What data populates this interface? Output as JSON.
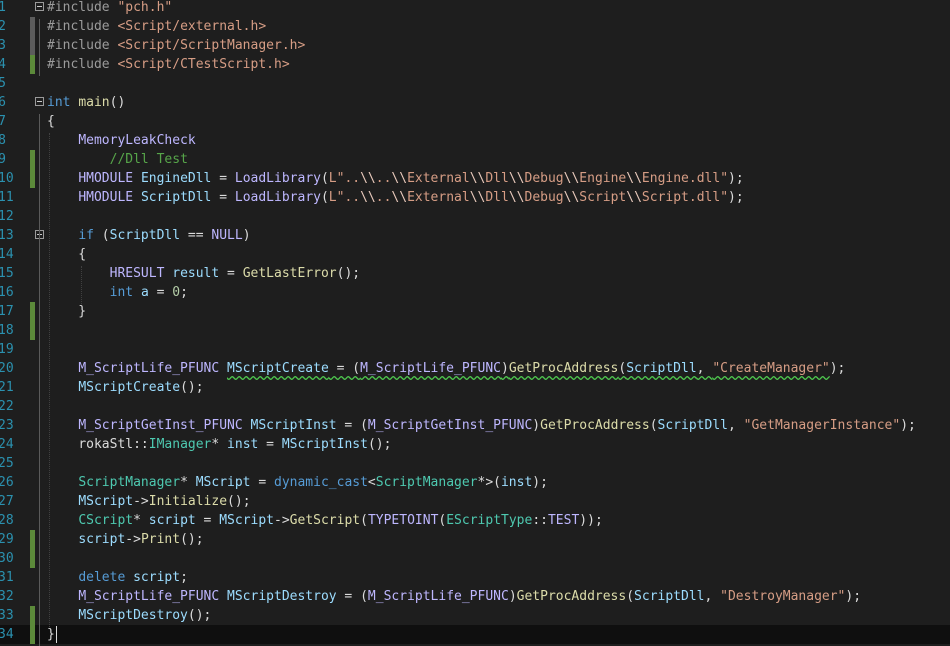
{
  "editor": {
    "lines": [
      {
        "num": "1",
        "change": "none",
        "fold": true,
        "tokens": [
          {
            "t": "#include ",
            "c": "pre"
          },
          {
            "t": "\"pch.h\"",
            "c": "str"
          }
        ]
      },
      {
        "num": "2",
        "change": "edited",
        "fold": false,
        "tokens": [
          {
            "t": "#include ",
            "c": "pre"
          },
          {
            "t": "<Script/external.h>",
            "c": "str"
          }
        ]
      },
      {
        "num": "3",
        "change": "edited",
        "fold": false,
        "tokens": [
          {
            "t": "#include ",
            "c": "pre"
          },
          {
            "t": "<Script/ScriptManager.h>",
            "c": "str"
          }
        ]
      },
      {
        "num": "4",
        "change": "saved",
        "fold": false,
        "tokens": [
          {
            "t": "#include ",
            "c": "pre"
          },
          {
            "t": "<Script/CTestScript.h>",
            "c": "str"
          }
        ]
      },
      {
        "num": "5",
        "change": "none",
        "fold": false,
        "tokens": []
      },
      {
        "num": "6",
        "change": "none",
        "fold": true,
        "tokens": [
          {
            "t": "int",
            "c": "kw"
          },
          {
            "t": " ",
            "c": "pl"
          },
          {
            "t": "main",
            "c": "fn"
          },
          {
            "t": "()",
            "c": "pl"
          }
        ]
      },
      {
        "num": "7",
        "change": "none",
        "fold": false,
        "tokens": [
          {
            "t": "{",
            "c": "pl"
          }
        ]
      },
      {
        "num": "8",
        "change": "none",
        "fold": false,
        "tokens": [
          {
            "t": "    ",
            "c": "pl"
          },
          {
            "t": "MemoryLeakCheck",
            "c": "mac"
          }
        ]
      },
      {
        "num": "9",
        "change": "saved",
        "fold": false,
        "tokens": [
          {
            "t": "        ",
            "c": "pl"
          },
          {
            "t": "//Dll Test",
            "c": "com"
          }
        ]
      },
      {
        "num": "10",
        "change": "saved",
        "fold": false,
        "tokens": [
          {
            "t": "    ",
            "c": "pl"
          },
          {
            "t": "HMODULE",
            "c": "mac"
          },
          {
            "t": " ",
            "c": "pl"
          },
          {
            "t": "EngineDll",
            "c": "var"
          },
          {
            "t": " = ",
            "c": "pl"
          },
          {
            "t": "LoadLibrary",
            "c": "mac"
          },
          {
            "t": "(",
            "c": "pl"
          },
          {
            "t": "L\"..",
            "c": "str"
          },
          {
            "t": "\\\\",
            "c": "esc"
          },
          {
            "t": "..",
            "c": "str"
          },
          {
            "t": "\\\\",
            "c": "esc"
          },
          {
            "t": "External",
            "c": "str"
          },
          {
            "t": "\\\\",
            "c": "esc"
          },
          {
            "t": "Dll",
            "c": "str"
          },
          {
            "t": "\\\\",
            "c": "esc"
          },
          {
            "t": "Debug",
            "c": "str"
          },
          {
            "t": "\\\\",
            "c": "esc"
          },
          {
            "t": "Engine",
            "c": "str"
          },
          {
            "t": "\\\\",
            "c": "esc"
          },
          {
            "t": "Engine.dll\"",
            "c": "str"
          },
          {
            "t": ");",
            "c": "pl"
          }
        ]
      },
      {
        "num": "11",
        "change": "none",
        "fold": false,
        "tokens": [
          {
            "t": "    ",
            "c": "pl"
          },
          {
            "t": "HMODULE",
            "c": "mac"
          },
          {
            "t": " ",
            "c": "pl"
          },
          {
            "t": "ScriptDll",
            "c": "var"
          },
          {
            "t": " = ",
            "c": "pl"
          },
          {
            "t": "LoadLibrary",
            "c": "mac"
          },
          {
            "t": "(",
            "c": "pl"
          },
          {
            "t": "L\"..",
            "c": "str"
          },
          {
            "t": "\\\\",
            "c": "esc"
          },
          {
            "t": "..",
            "c": "str"
          },
          {
            "t": "\\\\",
            "c": "esc"
          },
          {
            "t": "External",
            "c": "str"
          },
          {
            "t": "\\\\",
            "c": "esc"
          },
          {
            "t": "Dll",
            "c": "str"
          },
          {
            "t": "\\\\",
            "c": "esc"
          },
          {
            "t": "Debug",
            "c": "str"
          },
          {
            "t": "\\\\",
            "c": "esc"
          },
          {
            "t": "Script",
            "c": "str"
          },
          {
            "t": "\\\\",
            "c": "esc"
          },
          {
            "t": "Script.dll\"",
            "c": "str"
          },
          {
            "t": ");",
            "c": "pl"
          }
        ]
      },
      {
        "num": "12",
        "change": "none",
        "fold": false,
        "tokens": []
      },
      {
        "num": "13",
        "change": "none",
        "fold": true,
        "tokens": [
          {
            "t": "    ",
            "c": "pl"
          },
          {
            "t": "if",
            "c": "kw"
          },
          {
            "t": " (",
            "c": "pl"
          },
          {
            "t": "ScriptDll",
            "c": "var"
          },
          {
            "t": " == ",
            "c": "pl"
          },
          {
            "t": "NULL",
            "c": "mac"
          },
          {
            "t": ")",
            "c": "pl"
          }
        ]
      },
      {
        "num": "14",
        "change": "none",
        "fold": false,
        "tokens": [
          {
            "t": "    {",
            "c": "pl"
          }
        ]
      },
      {
        "num": "15",
        "change": "none",
        "fold": false,
        "tokens": [
          {
            "t": "        ",
            "c": "pl"
          },
          {
            "t": "HRESULT",
            "c": "mac"
          },
          {
            "t": " ",
            "c": "pl"
          },
          {
            "t": "result",
            "c": "var"
          },
          {
            "t": " = ",
            "c": "pl"
          },
          {
            "t": "GetLastError",
            "c": "fn"
          },
          {
            "t": "();",
            "c": "pl"
          }
        ]
      },
      {
        "num": "16",
        "change": "none",
        "fold": false,
        "tokens": [
          {
            "t": "        ",
            "c": "pl"
          },
          {
            "t": "int",
            "c": "kw"
          },
          {
            "t": " ",
            "c": "pl"
          },
          {
            "t": "a",
            "c": "var"
          },
          {
            "t": " = ",
            "c": "pl"
          },
          {
            "t": "0",
            "c": "num"
          },
          {
            "t": ";",
            "c": "pl"
          }
        ]
      },
      {
        "num": "17",
        "change": "saved",
        "fold": false,
        "tokens": [
          {
            "t": "    }",
            "c": "pl"
          }
        ]
      },
      {
        "num": "18",
        "change": "saved",
        "fold": false,
        "tokens": []
      },
      {
        "num": "19",
        "change": "none",
        "fold": false,
        "tokens": []
      },
      {
        "num": "20",
        "change": "none",
        "fold": false,
        "tokens": [
          {
            "t": "    ",
            "c": "pl"
          },
          {
            "t": "M_ScriptLife_PFUNC",
            "c": "mac"
          },
          {
            "t": " ",
            "c": "pl"
          },
          {
            "t": "MScriptCreate",
            "c": "var",
            "squig": true
          },
          {
            "t": " = (",
            "c": "pl",
            "squig": true
          },
          {
            "t": "M_ScriptLife_PFUNC",
            "c": "mac",
            "squig": true
          },
          {
            "t": ")",
            "c": "pl",
            "squig": true
          },
          {
            "t": "GetProcAddress",
            "c": "fn",
            "squig": true
          },
          {
            "t": "(",
            "c": "pl",
            "squig": true
          },
          {
            "t": "ScriptDll",
            "c": "var",
            "squig": true
          },
          {
            "t": ", ",
            "c": "pl",
            "squig": true
          },
          {
            "t": "\"CreateManager\"",
            "c": "str",
            "squig": true
          },
          {
            "t": ");",
            "c": "pl"
          }
        ]
      },
      {
        "num": "21",
        "change": "none",
        "fold": false,
        "tokens": [
          {
            "t": "    ",
            "c": "pl"
          },
          {
            "t": "MScriptCreate",
            "c": "var"
          },
          {
            "t": "();",
            "c": "pl"
          }
        ]
      },
      {
        "num": "22",
        "change": "none",
        "fold": false,
        "tokens": []
      },
      {
        "num": "23",
        "change": "none",
        "fold": false,
        "tokens": [
          {
            "t": "    ",
            "c": "pl"
          },
          {
            "t": "M_ScriptGetInst_PFUNC",
            "c": "mac"
          },
          {
            "t": " ",
            "c": "pl"
          },
          {
            "t": "MScriptInst",
            "c": "var"
          },
          {
            "t": " = (",
            "c": "pl"
          },
          {
            "t": "M_ScriptGetInst_PFUNC",
            "c": "mac"
          },
          {
            "t": ")",
            "c": "pl"
          },
          {
            "t": "GetProcAddress",
            "c": "fn"
          },
          {
            "t": "(",
            "c": "pl"
          },
          {
            "t": "ScriptDll",
            "c": "var"
          },
          {
            "t": ", ",
            "c": "pl"
          },
          {
            "t": "\"GetManagerInstance\"",
            "c": "str"
          },
          {
            "t": ");",
            "c": "pl"
          }
        ]
      },
      {
        "num": "24",
        "change": "none",
        "fold": false,
        "tokens": [
          {
            "t": "    ",
            "c": "pl"
          },
          {
            "t": "rokaStl",
            "c": "pl"
          },
          {
            "t": "::",
            "c": "pl"
          },
          {
            "t": "IManager",
            "c": "typ"
          },
          {
            "t": "* ",
            "c": "pl"
          },
          {
            "t": "inst",
            "c": "var"
          },
          {
            "t": " = ",
            "c": "pl"
          },
          {
            "t": "MScriptInst",
            "c": "var"
          },
          {
            "t": "();",
            "c": "pl"
          }
        ]
      },
      {
        "num": "25",
        "change": "none",
        "fold": false,
        "tokens": []
      },
      {
        "num": "26",
        "change": "none",
        "fold": false,
        "tokens": [
          {
            "t": "    ",
            "c": "pl"
          },
          {
            "t": "ScriptManager",
            "c": "typ"
          },
          {
            "t": "* ",
            "c": "pl"
          },
          {
            "t": "MScript",
            "c": "var"
          },
          {
            "t": " = ",
            "c": "pl"
          },
          {
            "t": "dynamic_cast",
            "c": "kw"
          },
          {
            "t": "<",
            "c": "pl"
          },
          {
            "t": "ScriptManager",
            "c": "typ"
          },
          {
            "t": "*>(",
            "c": "pl"
          },
          {
            "t": "inst",
            "c": "var"
          },
          {
            "t": ");",
            "c": "pl"
          }
        ]
      },
      {
        "num": "27",
        "change": "none",
        "fold": false,
        "tokens": [
          {
            "t": "    ",
            "c": "pl"
          },
          {
            "t": "MScript",
            "c": "var"
          },
          {
            "t": "->",
            "c": "pl"
          },
          {
            "t": "Initialize",
            "c": "fn"
          },
          {
            "t": "();",
            "c": "pl"
          }
        ]
      },
      {
        "num": "28",
        "change": "none",
        "fold": false,
        "tokens": [
          {
            "t": "    ",
            "c": "pl"
          },
          {
            "t": "CScript",
            "c": "typ"
          },
          {
            "t": "* ",
            "c": "pl"
          },
          {
            "t": "script",
            "c": "var"
          },
          {
            "t": " = ",
            "c": "pl"
          },
          {
            "t": "MScript",
            "c": "var"
          },
          {
            "t": "->",
            "c": "pl"
          },
          {
            "t": "GetScript",
            "c": "fn"
          },
          {
            "t": "(",
            "c": "pl"
          },
          {
            "t": "TYPETOINT",
            "c": "mac"
          },
          {
            "t": "(",
            "c": "pl"
          },
          {
            "t": "EScriptType",
            "c": "typ"
          },
          {
            "t": "::",
            "c": "pl"
          },
          {
            "t": "TEST",
            "c": "mac"
          },
          {
            "t": "));",
            "c": "pl"
          }
        ]
      },
      {
        "num": "29",
        "change": "saved",
        "fold": false,
        "tokens": [
          {
            "t": "    ",
            "c": "pl"
          },
          {
            "t": "script",
            "c": "var"
          },
          {
            "t": "->",
            "c": "pl"
          },
          {
            "t": "Print",
            "c": "fn"
          },
          {
            "t": "();",
            "c": "pl"
          }
        ]
      },
      {
        "num": "30",
        "change": "saved",
        "fold": false,
        "tokens": []
      },
      {
        "num": "31",
        "change": "none",
        "fold": false,
        "tokens": [
          {
            "t": "    ",
            "c": "pl"
          },
          {
            "t": "delete",
            "c": "kw"
          },
          {
            "t": " ",
            "c": "pl"
          },
          {
            "t": "script",
            "c": "var"
          },
          {
            "t": ";",
            "c": "pl"
          }
        ]
      },
      {
        "num": "32",
        "change": "none",
        "fold": false,
        "tokens": [
          {
            "t": "    ",
            "c": "pl"
          },
          {
            "t": "M_ScriptLife_PFUNC",
            "c": "mac"
          },
          {
            "t": " ",
            "c": "pl"
          },
          {
            "t": "MScriptDestroy",
            "c": "var"
          },
          {
            "t": " = (",
            "c": "pl"
          },
          {
            "t": "M_ScriptLife_PFUNC",
            "c": "mac"
          },
          {
            "t": ")",
            "c": "pl"
          },
          {
            "t": "GetProcAddress",
            "c": "fn"
          },
          {
            "t": "(",
            "c": "pl"
          },
          {
            "t": "ScriptDll",
            "c": "var"
          },
          {
            "t": ", ",
            "c": "pl"
          },
          {
            "t": "\"DestroyManager\"",
            "c": "str"
          },
          {
            "t": ");",
            "c": "pl"
          }
        ]
      },
      {
        "num": "33",
        "change": "saved",
        "fold": false,
        "tokens": [
          {
            "t": "    ",
            "c": "pl"
          },
          {
            "t": "MScriptDestroy",
            "c": "var"
          },
          {
            "t": "();",
            "c": "pl"
          }
        ]
      },
      {
        "num": "34",
        "change": "saved",
        "fold": false,
        "current": true,
        "tokens": [
          {
            "t": "}",
            "c": "pl"
          }
        ]
      }
    ]
  }
}
